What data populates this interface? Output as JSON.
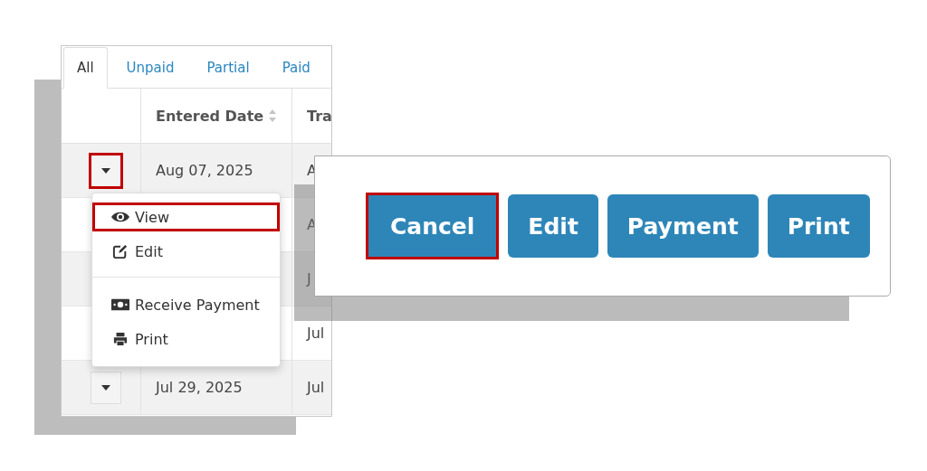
{
  "table_panel": {
    "tabs": [
      {
        "label": "All",
        "selected": true
      },
      {
        "label": "Unpaid",
        "selected": false
      },
      {
        "label": "Partial",
        "selected": false
      },
      {
        "label": "Paid",
        "selected": false
      }
    ],
    "columns": [
      {
        "label": "Entered Date",
        "sortable": true
      },
      {
        "label": "Tra"
      }
    ],
    "rows": [
      {
        "toggle": {
          "highlighted": true
        },
        "entered_date": "Aug 07, 2025",
        "column_3": "A"
      },
      {
        "column_3": "A"
      },
      {
        "column_3": "J"
      },
      {
        "column_3": "Jul"
      },
      {
        "toggle": {
          "highlighted": false
        },
        "entered_date": "Jul 29, 2025",
        "column_3": "Jul"
      }
    ],
    "menu": {
      "groups": [
        [
          {
            "label": "View",
            "highlighted": true
          },
          {
            "label": "Edit",
            "highlighted": false
          }
        ],
        [
          {
            "label": "Receive Payment",
            "highlighted": false
          },
          {
            "label": "Print",
            "highlighted": false
          }
        ]
      ]
    }
  },
  "action_panel": {
    "buttons": [
      {
        "label": "Cancel",
        "highlighted": true
      },
      {
        "label": "Edit",
        "highlighted": false
      },
      {
        "label": "Payment",
        "highlighted": false
      },
      {
        "label": "Print",
        "highlighted": false
      }
    ]
  }
}
